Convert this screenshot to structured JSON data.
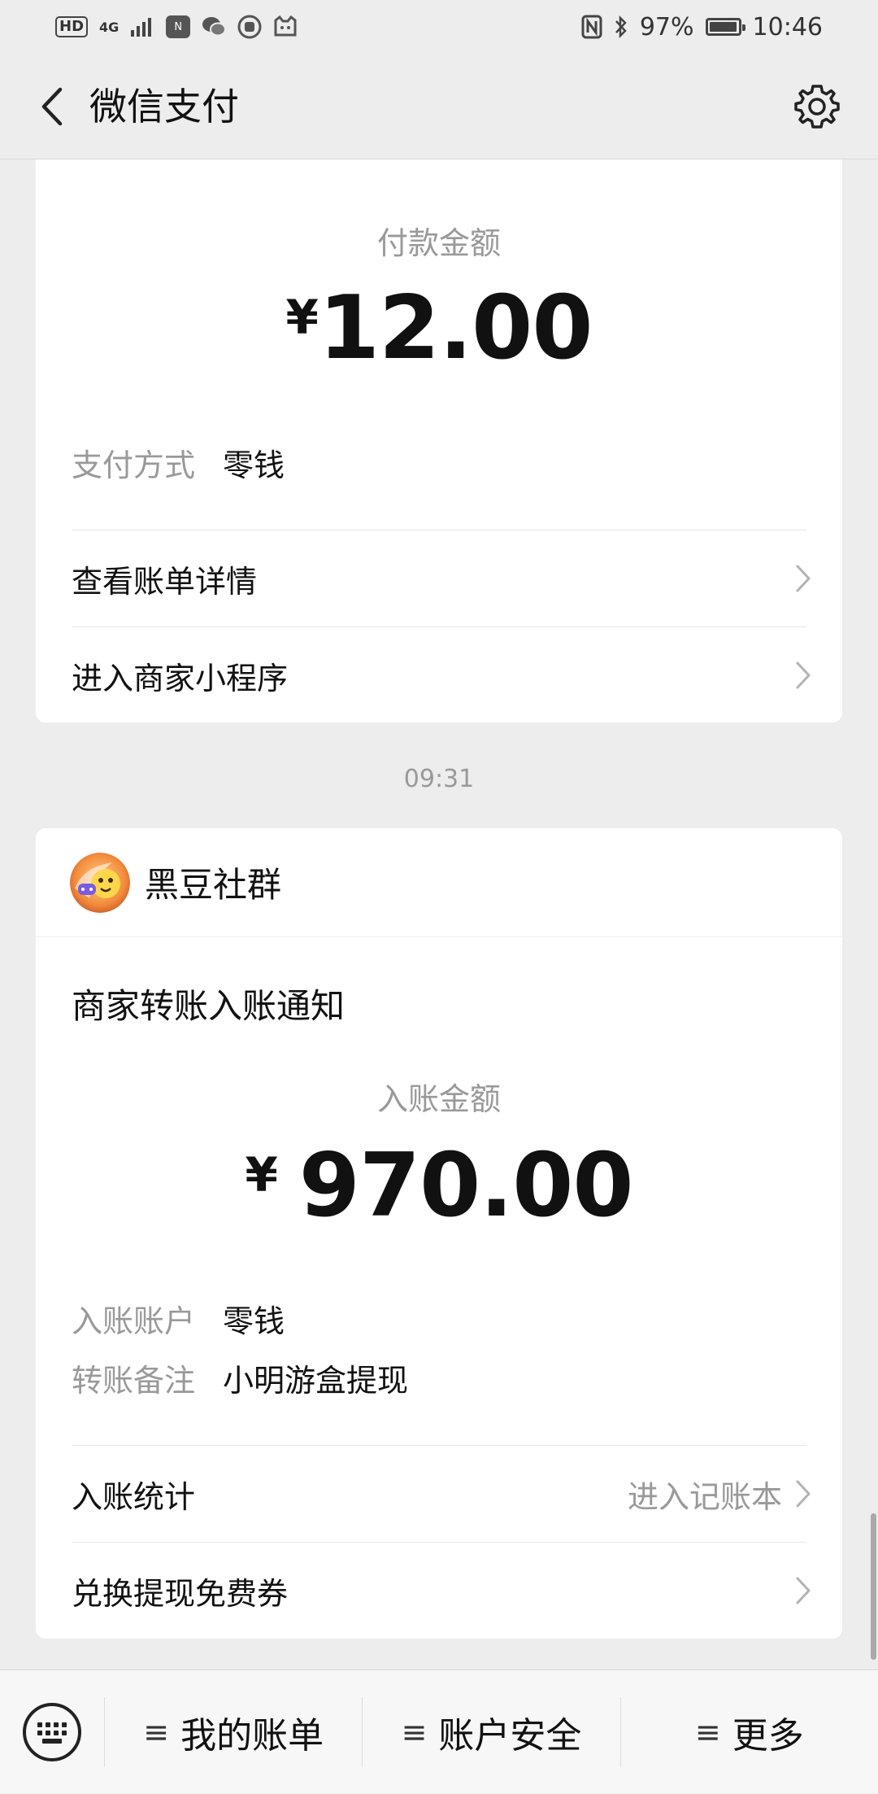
{
  "status_bar": {
    "left_icons": [
      "HD",
      "4G",
      "signal-icon",
      "nfc-app-icon",
      "wechat-icon",
      "fist-app-icon",
      "cat-app-icon"
    ],
    "battery": "97%",
    "battery_level": 0.97,
    "time": "10:46"
  },
  "header": {
    "title": "微信支付"
  },
  "payment_card": {
    "amount_label": "付款金额",
    "currency": "¥",
    "amount": "12.00",
    "method_key": "支付方式",
    "method_value": "零钱",
    "link_bill": "查看账单详情",
    "link_miniprogram": "进入商家小程序"
  },
  "timestamp": "09:31",
  "transfer_card": {
    "merchant": "黑豆社群",
    "notice_title": "商家转账入账通知",
    "amount_label": "入账金额",
    "currency": "¥",
    "amount": "970.00",
    "account_key": "入账账户",
    "account_value": "零钱",
    "note_key": "转账备注",
    "note_value": "小明游盒提现",
    "stats_label": "入账统计",
    "stats_hint": "进入记账本",
    "coupon_label": "兑换提现免费券"
  },
  "bottom_menu": {
    "items": [
      {
        "glyph": "≡",
        "label": "我的账单"
      },
      {
        "glyph": "≡",
        "label": "账户安全"
      },
      {
        "glyph": "≡",
        "label": "更多"
      }
    ]
  },
  "colors": {
    "background": "#ededed",
    "card": "#ffffff",
    "muted_text": "#999999"
  }
}
